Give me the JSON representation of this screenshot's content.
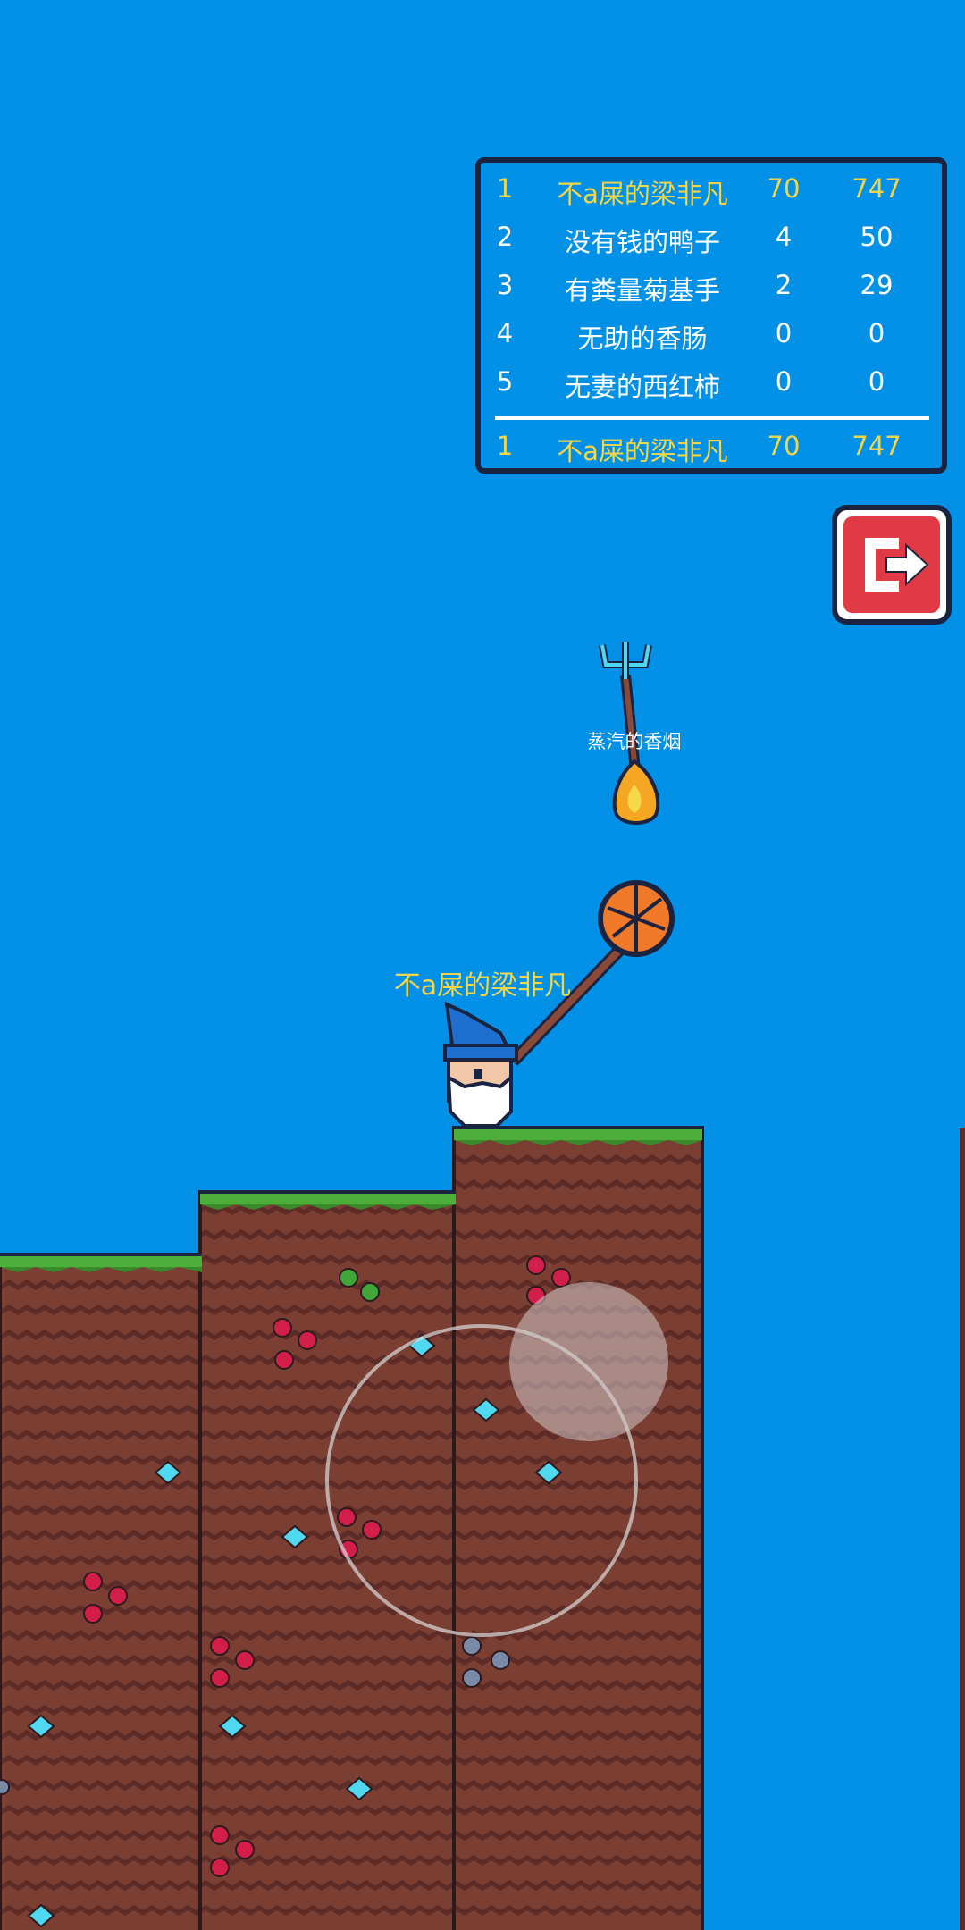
{
  "leaderboard": {
    "rows": [
      {
        "rank": "1",
        "name": "不a屎的梁非凡",
        "level": "70",
        "score": "747"
      },
      {
        "rank": "2",
        "name": "没有钱的鸭子",
        "level": "4",
        "score": "50"
      },
      {
        "rank": "3",
        "name": "有粪量菊基手",
        "level": "2",
        "score": "29"
      },
      {
        "rank": "4",
        "name": "无助的香肠",
        "level": "0",
        "score": "0"
      },
      {
        "rank": "5",
        "name": "无妻的西红柿",
        "level": "0",
        "score": "0"
      }
    ],
    "self": {
      "rank": "1",
      "name": "不a屎的梁非凡",
      "level": "70",
      "score": "747"
    }
  },
  "players": {
    "main_name": "不a屎的梁非凡",
    "other_name": "蒸汽的香烟"
  },
  "icons": {
    "exit": "exit-icon",
    "character": "wizard-icon",
    "trident": "trident-icon",
    "net": "net-icon",
    "flame": "flame-icon"
  },
  "colors": {
    "sky": "#0391e8",
    "highlight": "#f2d648",
    "dirt": "#7a3e32",
    "grass": "#4caf3a",
    "exit_button": "#e03a45"
  }
}
